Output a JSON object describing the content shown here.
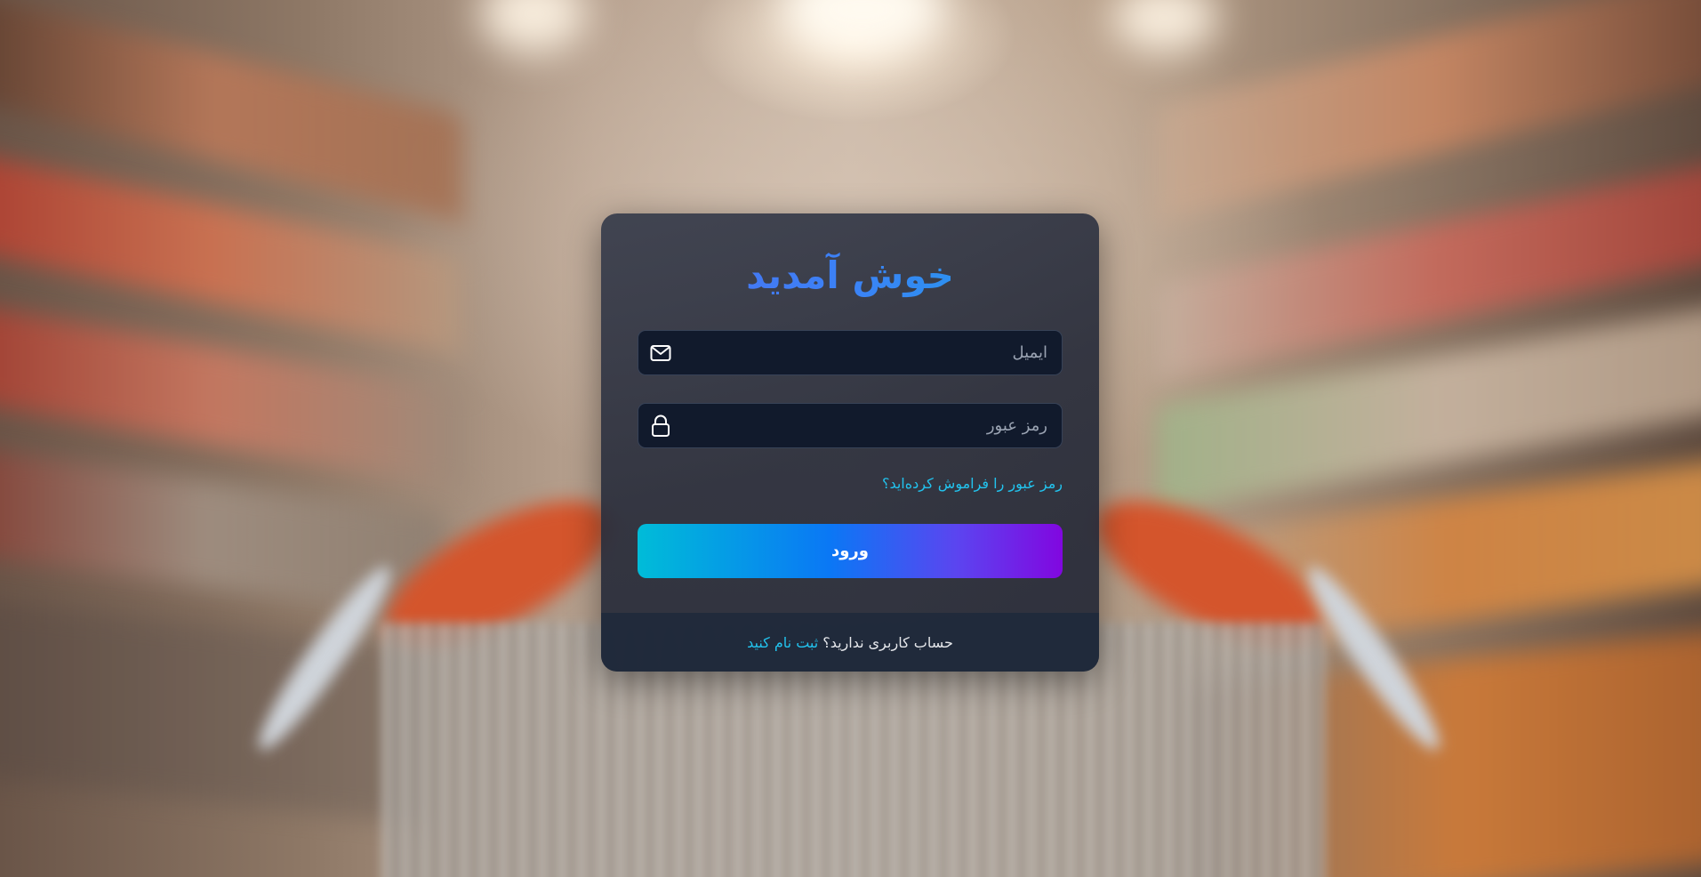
{
  "login": {
    "title": "خوش آمدید",
    "email": {
      "placeholder": "ایمیل",
      "value": "",
      "icon": "envelope-icon"
    },
    "password": {
      "placeholder": "رمز عبور",
      "value": "",
      "icon": "lock-icon"
    },
    "forgot_password": "رمز عبور را فراموش کرده‌اید؟",
    "submit_label": "ورود",
    "footer": {
      "question": "حساب کاربری ندارید؟",
      "register_link": "ثبت نام کنید"
    }
  },
  "colors": {
    "title_gradient": [
      "#4f6df0",
      "#1aa3e8"
    ],
    "button_gradient": [
      "#00bcd8",
      "#0a78f5",
      "#5b45f0",
      "#8107e0"
    ],
    "link": "#22c3ee",
    "card_bg": "#2c303d",
    "field_bg": "#111a2c"
  },
  "background": {
    "description_icon": "supermarket-aisle-blurred-photo"
  }
}
